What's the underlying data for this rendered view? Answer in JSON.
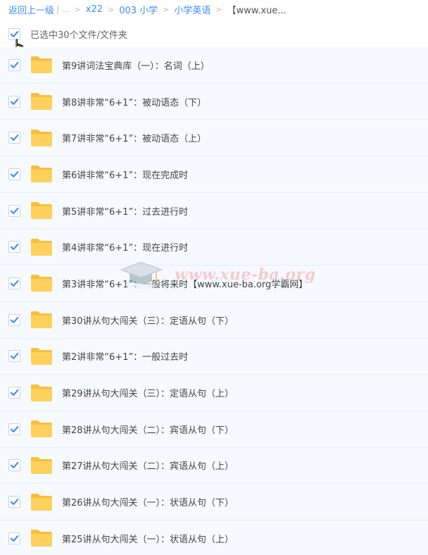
{
  "breadcrumb": {
    "back": "返回上一级",
    "pipe": "|",
    "ellipsis": "...",
    "arrow": ">",
    "items": [
      "x22",
      "003 小学",
      "小学英语"
    ],
    "current": "【www.xue..."
  },
  "selection": {
    "label": "已选中30个文件/文件夹",
    "checked": true
  },
  "files": [
    {
      "name": "第9讲词法宝典库（一）：名词（上）"
    },
    {
      "name": "第8讲非常“6+1”：被动语态（下）"
    },
    {
      "name": "第7讲非常“6+1”：被动语态（上）"
    },
    {
      "name": "第6讲非常“6+1”：现在完成时"
    },
    {
      "name": "第5讲非常“6+1”：过去进行时"
    },
    {
      "name": "第4讲非常“6+1”：现在进行时"
    },
    {
      "name": "第3讲非常“6+1”：一般将来时【www.xue-ba.org学霸网】"
    },
    {
      "name": "第30讲从句大闯关（三）：定语从句（下）"
    },
    {
      "name": "第2讲非常“6+1”：一般过去时"
    },
    {
      "name": "第29讲从句大闯关（三）：定语从句（上）"
    },
    {
      "name": "第28讲从句大闯关（二）：宾语从句（下）"
    },
    {
      "name": "第27讲从句大闯关（二）：宾语从句（上）"
    },
    {
      "name": "第26讲从句大闯关（一）：状语从句（下）"
    },
    {
      "name": "第25讲从句大闯关（一）：状语从句（上）"
    }
  ],
  "watermark": {
    "text": "www.xue-ba.org"
  },
  "colors": {
    "link": "#3b8cff",
    "check": "#3b8cff",
    "folder": "#ffd15c",
    "folder_tab": "#f7bf3a",
    "row_bg": "#f6fafe"
  },
  "icons": {
    "checkbox": "check-icon",
    "folder": "folder-icon",
    "cursor": "hand-pointer-icon",
    "watermark": "graduation-cap-icon"
  }
}
